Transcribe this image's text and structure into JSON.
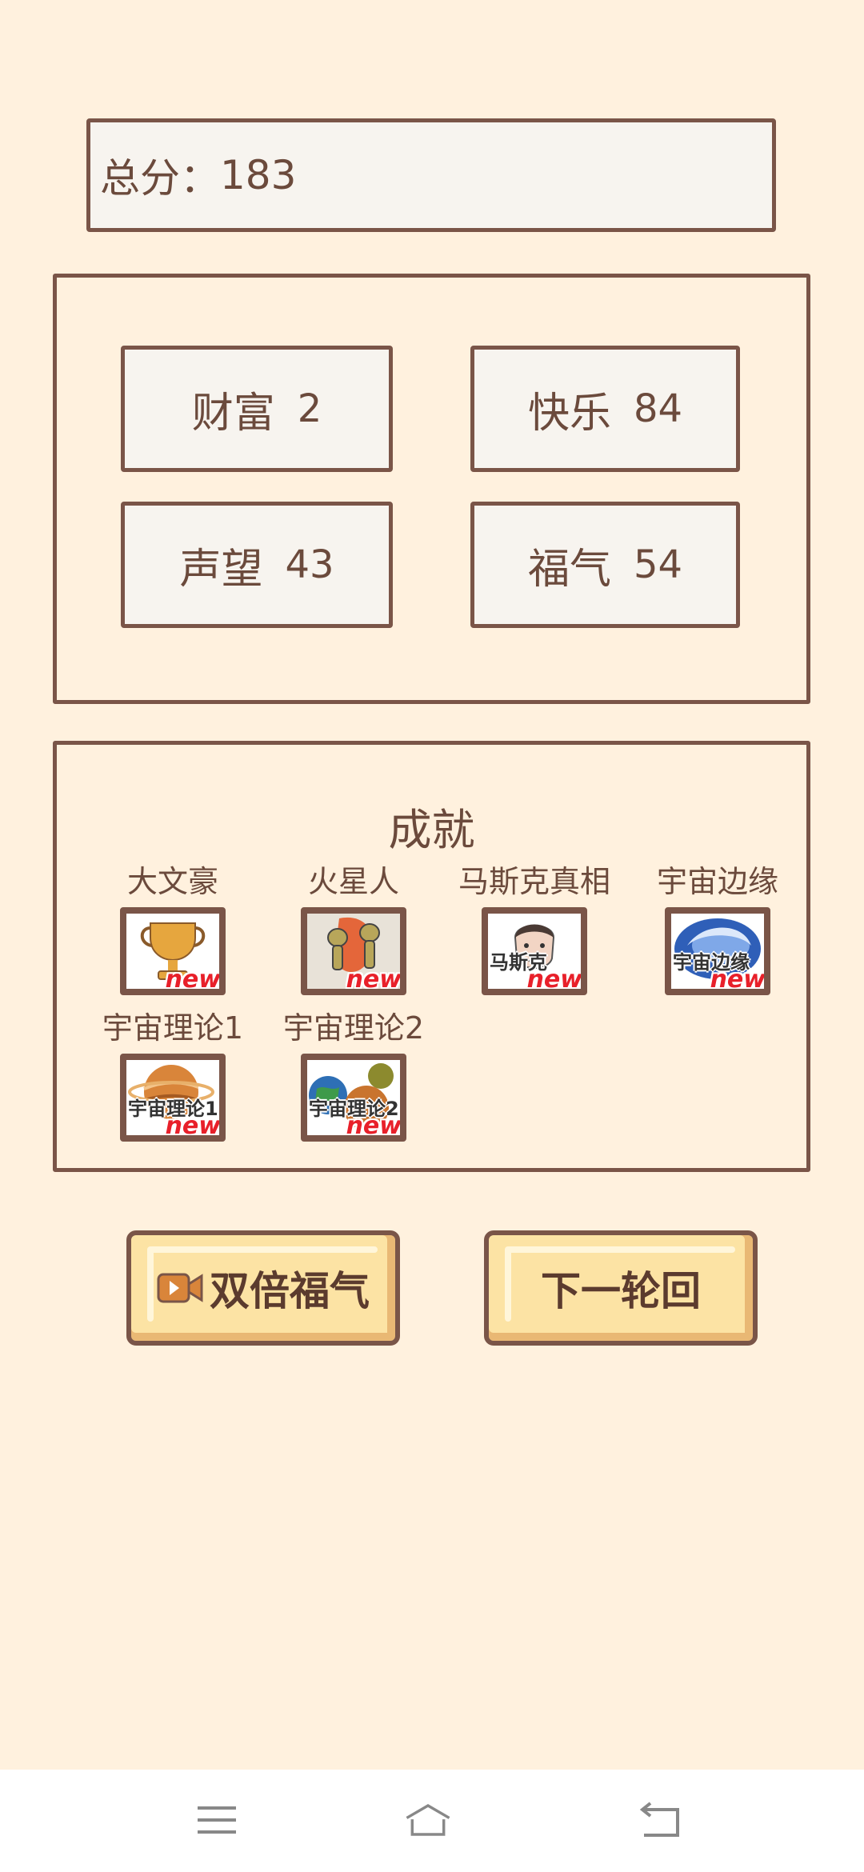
{
  "score": {
    "label": "总分：",
    "value": "183"
  },
  "stats": {
    "wealth": {
      "label": "财富",
      "value": "2"
    },
    "happiness": {
      "label": "快乐",
      "value": "84"
    },
    "fame": {
      "label": "声望",
      "value": "43"
    },
    "luck": {
      "label": "福气",
      "value": "54"
    }
  },
  "achievements": {
    "title": "成就",
    "new_badge": "new",
    "items": [
      {
        "name": "大文豪",
        "icon": "trophy-icon"
      },
      {
        "name": "火星人",
        "icon": "martians-icon"
      },
      {
        "name": "马斯克真相",
        "icon": "portrait-icon",
        "image_text": "马斯克"
      },
      {
        "name": "宇宙边缘",
        "icon": "galaxy-icon",
        "image_text": "宇宙边缘"
      },
      {
        "name": "宇宙理论1",
        "icon": "planet-icon",
        "image_text": "宇宙理论1"
      },
      {
        "name": "宇宙理论2",
        "icon": "planets-icon",
        "image_text": "宇宙理论2"
      }
    ]
  },
  "buttons": {
    "double_luck": "双倍福气",
    "next_round": "下一轮回"
  },
  "colors": {
    "background": "#FFF1DE",
    "border": "#7A5548",
    "button_fill": "#FCE3A4",
    "new_badge": "#E8202A"
  }
}
